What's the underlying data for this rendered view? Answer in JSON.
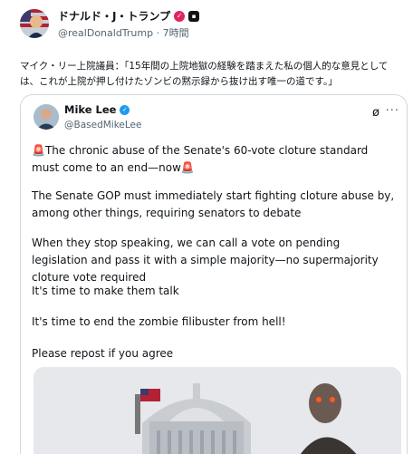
{
  "post": {
    "author_name": "ドナルド・J・トランプ",
    "author_handle": "@realDonaldTrump",
    "time": "· 7時間",
    "text": "マイク・リー上院議員：「15年間の上院地獄の経験を踏まえた私の個人的な意見としては、これが上院が押し付けたゾンビの黙示録から抜け出す唯一の道です。」"
  },
  "quote": {
    "author_name": "Mike Lee",
    "author_handle": "@BasedMikeLee",
    "line1": "The chronic abuse of the Senate's 60-vote cloture standard must come to an end—now",
    "line2": "The Senate GOP must immediately start fighting cloture abuse by, among other things, requiring senators to debate",
    "line3": "When they stop speaking, we can call a vote on pending legislation and pass it with a simple majority—no supermajority cloture vote required",
    "line4": "It's time to make them talk",
    "line5": "It's time to end the zombie filibuster from hell!",
    "line6": "Please repost if you agree"
  },
  "icons": {
    "siren": "🚨",
    "verified": "✓",
    "grok": "ø",
    "more": "···"
  },
  "colors": {
    "handle_gray": "#536471",
    "verified_blue": "#1d9bf0",
    "border": "#cfd9de"
  }
}
